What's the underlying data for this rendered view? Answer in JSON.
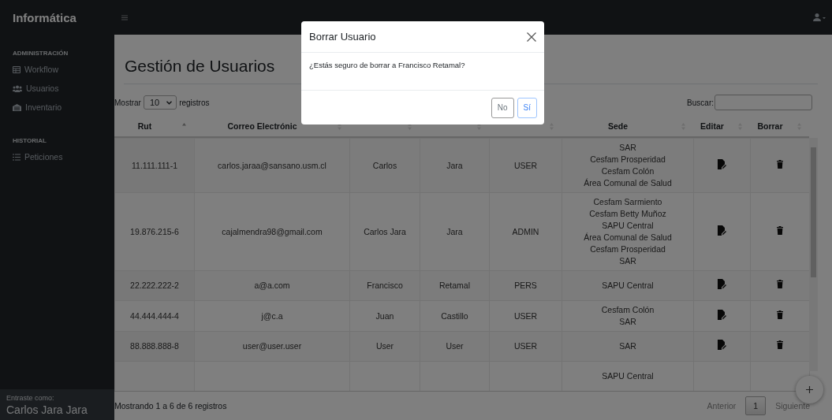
{
  "sidebar": {
    "brand": "Informática",
    "sections": [
      {
        "heading": "ADMINISTRACIÓN",
        "items": [
          {
            "label": "Workflow"
          },
          {
            "label": "Usuarios"
          },
          {
            "label": "Inventario"
          }
        ]
      },
      {
        "heading": "HISTORIAL",
        "items": [
          {
            "label": "Peticiones"
          }
        ]
      }
    ],
    "user_caption": "Entraste como:",
    "user_name": "Carlos Jara Jara"
  },
  "page": {
    "title": "Gestión de Usuarios"
  },
  "table_controls": {
    "length_before": "Mostrar",
    "length_value": "10",
    "length_after": "registros",
    "search_label": "Buscar:"
  },
  "table": {
    "columns": [
      {
        "label": "Rut",
        "sorted": true
      },
      {
        "label": "Correo Electrónic",
        "sorted": false
      },
      {
        "sorted": false
      },
      {
        "sorted": false
      },
      {
        "sorted": false
      },
      {
        "label": "Sede",
        "sorted": false
      },
      {
        "label": "Editar",
        "sorted": false
      },
      {
        "label": "Borrar",
        "sorted": false
      }
    ],
    "rows": [
      {
        "rut": "11.111.111-1",
        "email": "carlos.jaraa@sansano.usm.cl",
        "nombre": "Carlos",
        "apellido": "Jara",
        "rol": "USER",
        "sede": [
          "SAR",
          "Cesfam Prosperidad",
          "Cesfam Colón",
          "Área Comunal de Salud"
        ],
        "actions": true
      },
      {
        "rut": "19.876.215-6",
        "email": "cajalmendra98@gmail.com",
        "nombre": "Carlos Jara",
        "apellido": "Jara",
        "rol": "ADMIN",
        "sede": [
          "Cesfam Sarmiento",
          "Cesfam Betty Muñoz",
          "SAPU Central",
          "Área Comunal de Salud",
          "Cesfam Prosperidad",
          "SAR"
        ],
        "actions": true
      },
      {
        "rut": "22.222.222-2",
        "email": "a@a.com",
        "nombre": "Francisco",
        "apellido": "Retamal",
        "rol": "PERS",
        "sede": [
          "SAPU Central"
        ],
        "actions": true
      },
      {
        "rut": "44.444.444-4",
        "email": "j@c.a",
        "nombre": "Juan",
        "apellido": "Castillo",
        "rol": "USER",
        "sede": [
          "Cesfam Colón",
          "SAR"
        ],
        "actions": true
      },
      {
        "rut": "88.888.888-8",
        "email": "user@user.user",
        "nombre": "User",
        "apellido": "User",
        "rol": "USER",
        "sede": [
          "SAR"
        ],
        "actions": true
      },
      {
        "sede": [
          "SAPU Central"
        ],
        "actions": false
      }
    ]
  },
  "footer": {
    "info": "Mostrando 1 a 6 de 6 registros",
    "pages": [
      {
        "label": "Anterior",
        "disabled": true,
        "selected": false
      },
      {
        "label": "1",
        "disabled": false,
        "selected": true
      },
      {
        "label": "Siguiente",
        "disabled": true,
        "selected": false
      }
    ]
  },
  "modal": {
    "title": "Borrar Usuario",
    "message": "¿Estás seguro de borrar a Francisco Retamal?",
    "buttons": [
      {
        "label": "No",
        "kind": "secondary"
      },
      {
        "label": "Sí",
        "kind": "primary"
      }
    ]
  }
}
